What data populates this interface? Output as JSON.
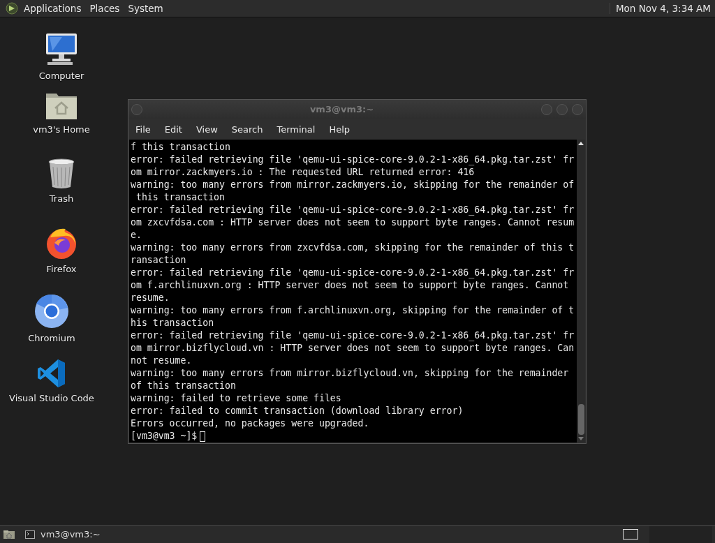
{
  "top_panel": {
    "menus": [
      "Applications",
      "Places",
      "System"
    ],
    "clock": "Mon Nov 4, 3:34 AM"
  },
  "desktop_icons": [
    {
      "label": "Computer",
      "kind": "computer"
    },
    {
      "label": "vm3's Home",
      "kind": "home"
    },
    {
      "label": "Trash",
      "kind": "trash"
    },
    {
      "label": "Firefox",
      "kind": "firefox"
    },
    {
      "label": "Chromium",
      "kind": "chromium"
    },
    {
      "label": "Visual Studio Code",
      "kind": "vscode"
    }
  ],
  "window": {
    "title": "vm3@vm3:~",
    "menu": [
      "File",
      "Edit",
      "View",
      "Search",
      "Terminal",
      "Help"
    ],
    "lines": [
      "f this transaction",
      "error: failed retrieving file 'qemu-ui-spice-core-9.0.2-1-x86_64.pkg.tar.zst' fr",
      "om mirror.zackmyers.io : The requested URL returned error: 416",
      "warning: too many errors from mirror.zackmyers.io, skipping for the remainder of",
      " this transaction",
      "error: failed retrieving file 'qemu-ui-spice-core-9.0.2-1-x86_64.pkg.tar.zst' fr",
      "om zxcvfdsa.com : HTTP server does not seem to support byte ranges. Cannot resum",
      "e.",
      "warning: too many errors from zxcvfdsa.com, skipping for the remainder of this t",
      "ransaction",
      "error: failed retrieving file 'qemu-ui-spice-core-9.0.2-1-x86_64.pkg.tar.zst' fr",
      "om f.archlinuxvn.org : HTTP server does not seem to support byte ranges. Cannot",
      "resume.",
      "warning: too many errors from f.archlinuxvn.org, skipping for the remainder of t",
      "his transaction",
      "error: failed retrieving file 'qemu-ui-spice-core-9.0.2-1-x86_64.pkg.tar.zst' fr",
      "om mirror.bizflycloud.vn : HTTP server does not seem to support byte ranges. Can",
      "not resume.",
      "warning: too many errors from mirror.bizflycloud.vn, skipping for the remainder",
      "of this transaction",
      "warning: failed to retrieve some files",
      "error: failed to commit transaction (download library error)",
      "Errors occurred, no packages were upgraded."
    ],
    "prompt": "[vm3@vm3 ~]$"
  },
  "taskbar": {
    "tasks": [
      {
        "label": "vm3@vm3:~",
        "selected": false
      }
    ]
  }
}
